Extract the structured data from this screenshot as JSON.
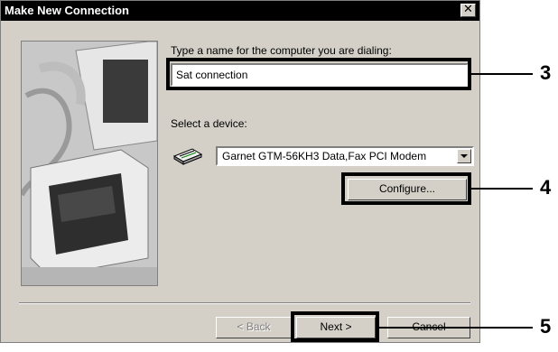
{
  "window": {
    "title": "Make New Connection",
    "close_glyph": "✕"
  },
  "name_section": {
    "label": "Type a name for the computer you are dialing:",
    "value": "Sat connection"
  },
  "device_section": {
    "label": "Select a device:",
    "selected": "Garnet GTM-56KH3 Data,Fax PCI Modem",
    "icon": "modem-icon"
  },
  "buttons": {
    "configure": "Configure...",
    "back": "< Back",
    "next": "Next >",
    "cancel": "Cancel"
  },
  "callouts": {
    "name_field": "3",
    "configure": "4",
    "next": "5"
  },
  "colors": {
    "face": "#d4d0c8",
    "titlebar": "#000000",
    "highlight": "#000000"
  }
}
